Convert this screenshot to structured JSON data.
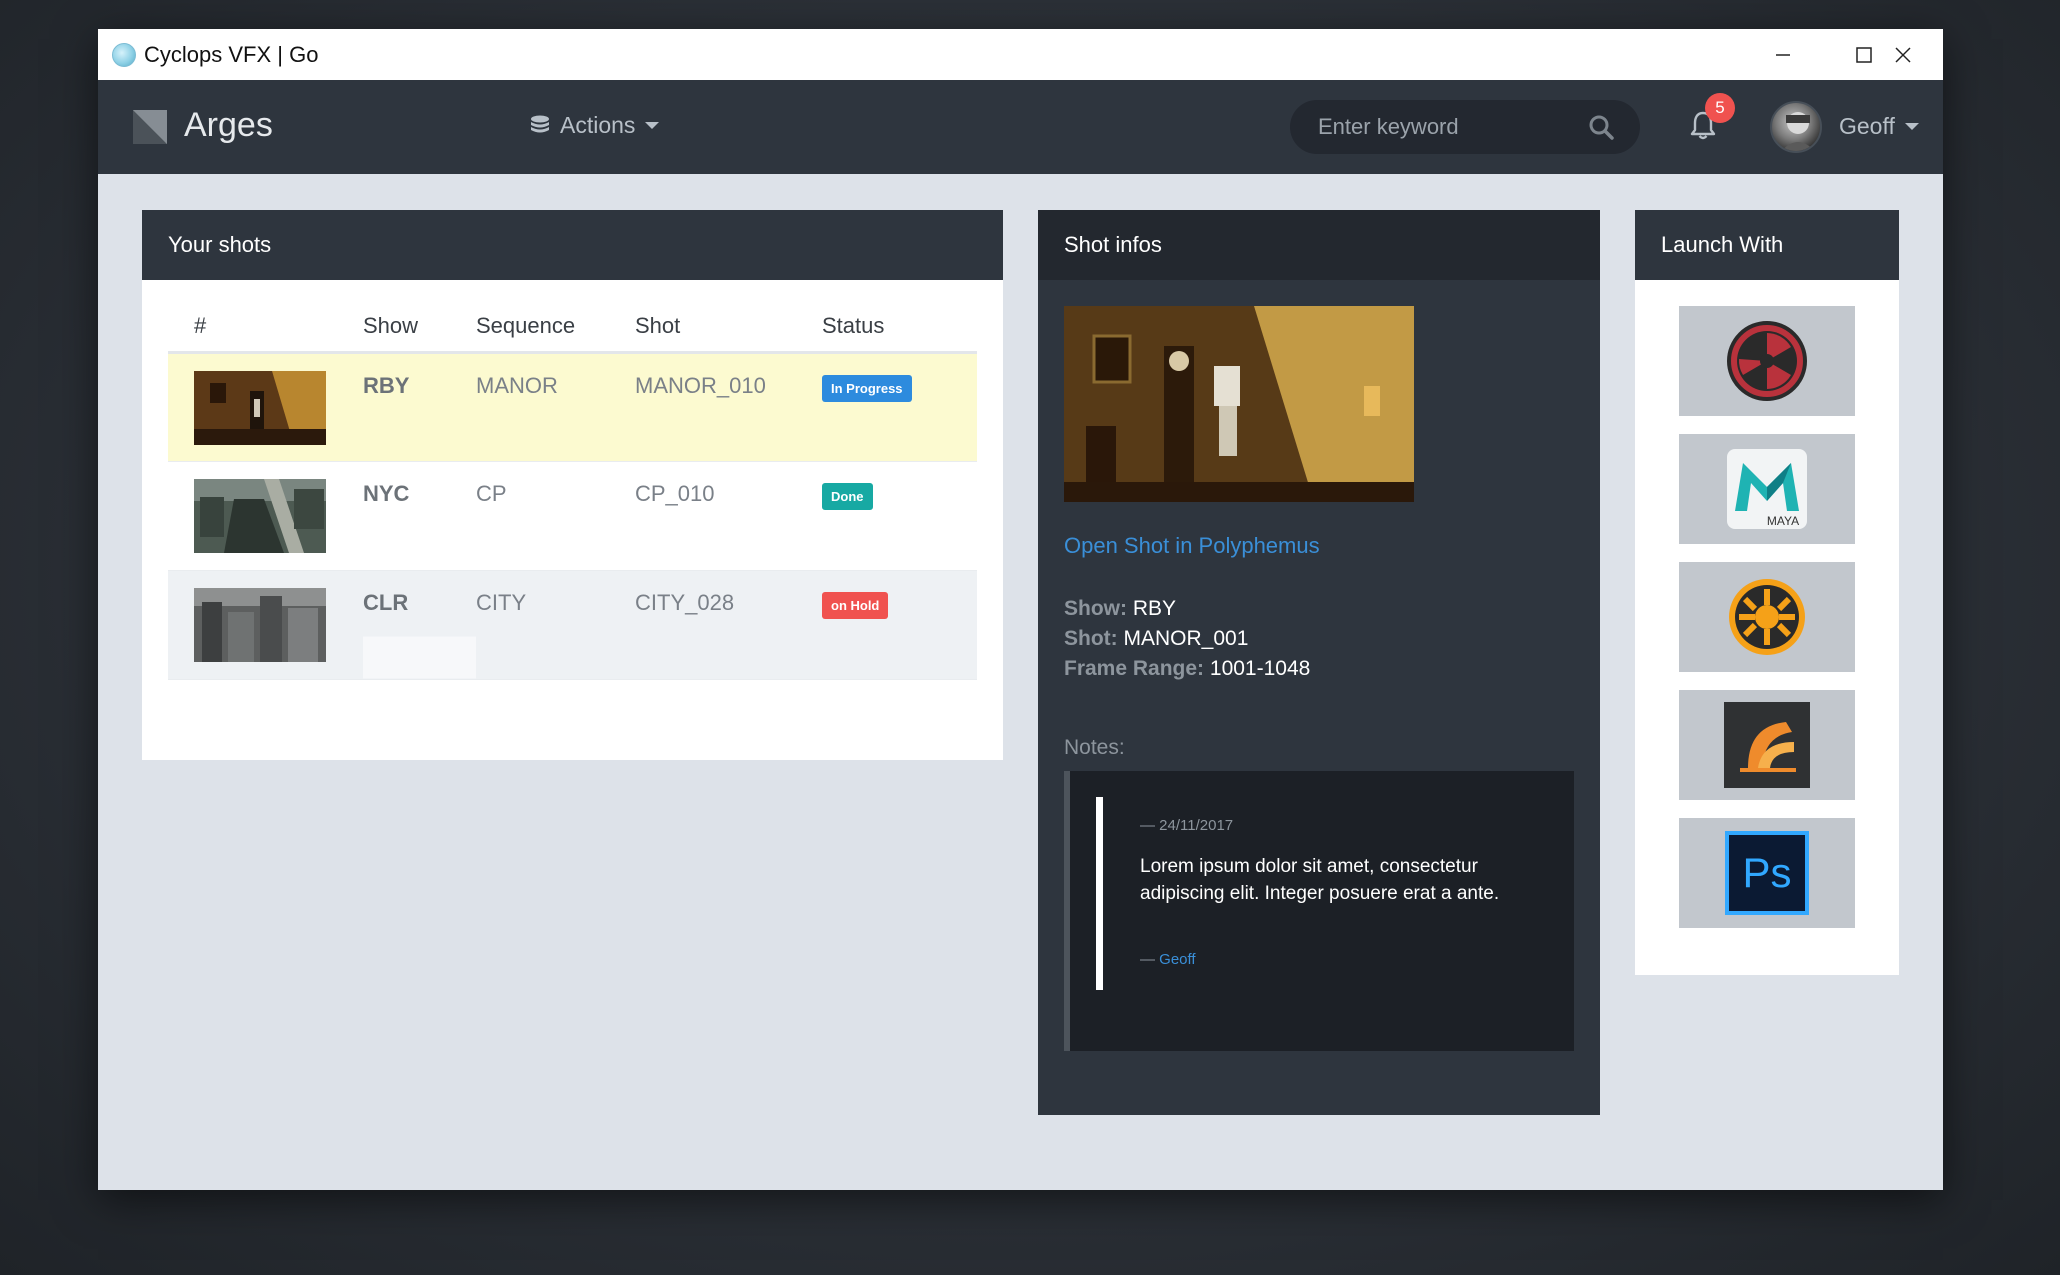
{
  "window": {
    "title": "Cyclops VFX | Go"
  },
  "navbar": {
    "brand": "Arges",
    "actions_label": "Actions",
    "search_placeholder": "Enter keyword",
    "notification_count": "5",
    "user_name": "Geoff"
  },
  "shots_panel": {
    "title": "Your shots",
    "columns": [
      "#",
      "Show",
      "Sequence",
      "Shot",
      "Status"
    ],
    "rows": [
      {
        "show": "RBY",
        "sequence": "MANOR",
        "shot": "MANOR_010",
        "status": "In Progress",
        "status_color": "#2d8bde",
        "selected": true
      },
      {
        "show": "NYC",
        "sequence": "CP",
        "shot": "CP_010",
        "status": "Done",
        "status_color": "#17a9a3",
        "selected": false
      },
      {
        "show": "CLR",
        "sequence": "CITY",
        "shot": "CITY_028",
        "status": "on Hold",
        "status_color": "#f0524f",
        "selected": false
      }
    ]
  },
  "infos_panel": {
    "title": "Shot infos",
    "open_link": "Open Shot in Polyphemus",
    "show_label": "Show:",
    "show_value": "RBY",
    "shot_label": "Shot:",
    "shot_value": "MANOR_001",
    "frame_label": "Frame Range:",
    "frame_value": "1001-1048",
    "notes_label": "Notes:",
    "note": {
      "date": "— 24/11/2017",
      "text": "Lorem ipsum dolor sit amet, consectetur adipiscing elit. Integer posuere erat a ante.",
      "author_prefix": "— ",
      "author": "Geoff"
    }
  },
  "launch_panel": {
    "title": "Launch With",
    "apps": [
      "nuke-icon",
      "maya-icon",
      "houdini-icon",
      "clarisse-icon",
      "photoshop-icon"
    ],
    "maya_label": "MAYA",
    "photoshop_label": "Ps"
  },
  "colors": {
    "navbar": "#2e353e",
    "accent_link": "#3a8fd8",
    "selected_row": "#fcfad0",
    "badge": "#f0524f"
  }
}
